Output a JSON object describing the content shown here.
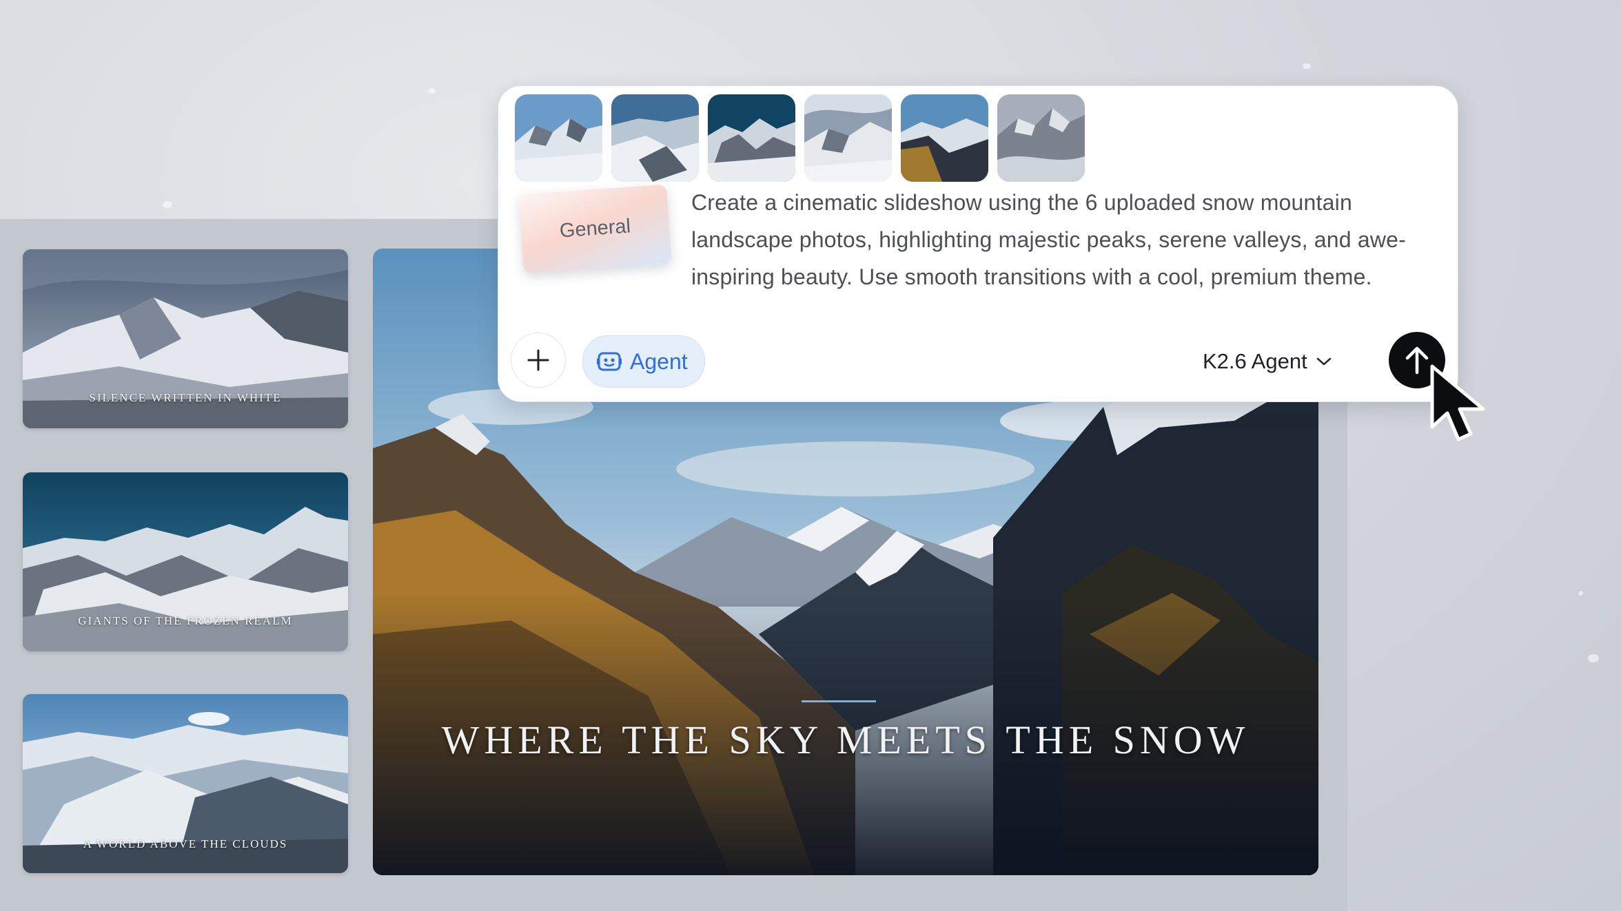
{
  "prompt": {
    "attachments": [
      {
        "name": "snow-mountain-photo-1"
      },
      {
        "name": "snow-mountain-photo-2"
      },
      {
        "name": "snow-mountain-photo-3"
      },
      {
        "name": "snow-mountain-photo-4"
      },
      {
        "name": "snow-mountain-photo-5"
      },
      {
        "name": "snow-mountain-photo-6"
      }
    ],
    "style_card_label": "General",
    "text": "Create a cinematic slideshow using the 6 uploaded snow mountain landscape photos, highlighting majestic peaks, serene valleys, and awe-inspiring beauty. Use smooth transitions with a cool, premium theme.",
    "text_lines": [
      "Create a cinematic slideshow using the 6 uploaded snow mountain",
      "landscape photos, highlighting majestic peaks, serene valleys, and awe-",
      "inspiring beauty. Use smooth transitions with a cool, premium theme."
    ],
    "add_icon": "plus-icon",
    "agent_chip": {
      "label": "Agent",
      "icon": "robot-icon"
    },
    "model_selector": {
      "label": "K2.6 Agent",
      "icon": "chevron-down-icon"
    },
    "send_icon": "arrow-up-icon"
  },
  "slides": {
    "thumbnails": [
      {
        "caption": "SILENCE WRITTEN IN WHITE"
      },
      {
        "caption": "GIANTS OF THE FROZEN REALM"
      },
      {
        "caption": "A WORLD ABOVE THE CLOUDS"
      }
    ],
    "main": {
      "title": "WHERE THE SKY MEETS THE SNOW"
    }
  },
  "colors": {
    "agent_accent": "#2c6fe0",
    "send_button": "#0c0d10",
    "title_rule": "#7fb2d9"
  }
}
